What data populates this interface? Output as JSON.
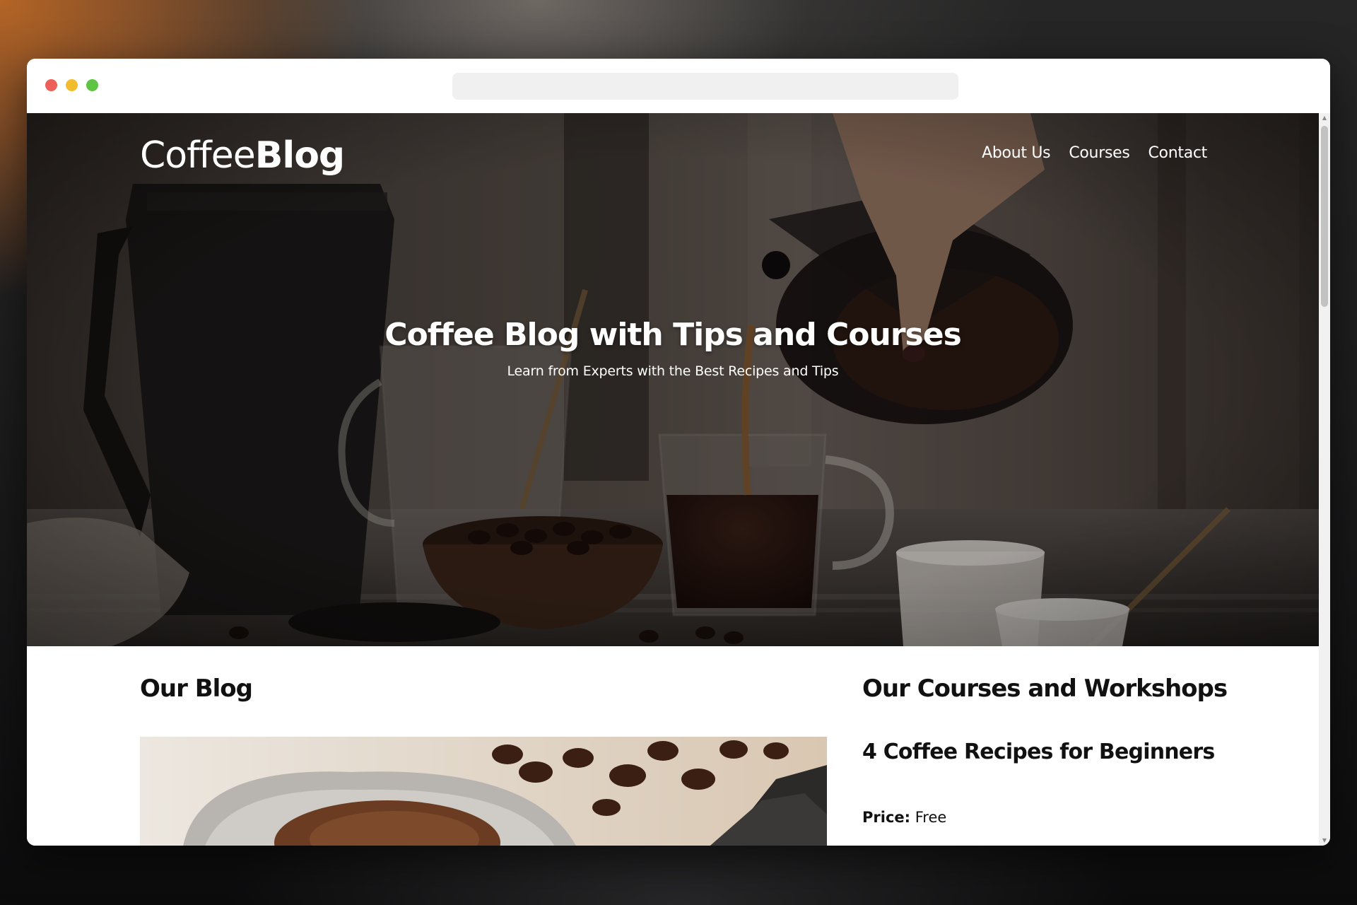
{
  "site": {
    "logo_light": "Coffee",
    "logo_bold": "Blog"
  },
  "nav": {
    "items": [
      {
        "label": "About Us"
      },
      {
        "label": "Courses"
      },
      {
        "label": "Contact"
      }
    ]
  },
  "hero": {
    "title": "Coffee Blog with Tips and Courses",
    "subtitle": "Learn from Experts with the Best Recipes and Tips"
  },
  "blog": {
    "heading": "Our Blog"
  },
  "courses": {
    "heading": "Our Courses and Workshops",
    "items": [
      {
        "title": "4 Coffee Recipes for Beginners",
        "price_label": "Price:",
        "price_value": "Free"
      }
    ]
  },
  "colors": {
    "window_bg": "#ffffff",
    "traffic_close": "#ee5f57",
    "traffic_minimize": "#f1bd2e",
    "traffic_zoom": "#5ec443",
    "url_bar": "#f0f0f0",
    "heading_text": "#111111",
    "hero_text": "#ffffff"
  },
  "icons": {
    "close": "close-dot-icon",
    "minimize": "minimize-dot-icon",
    "zoom": "zoom-dot-icon",
    "scroll_up": "scroll-up-arrow-icon",
    "scroll_down": "scroll-down-arrow-icon"
  }
}
